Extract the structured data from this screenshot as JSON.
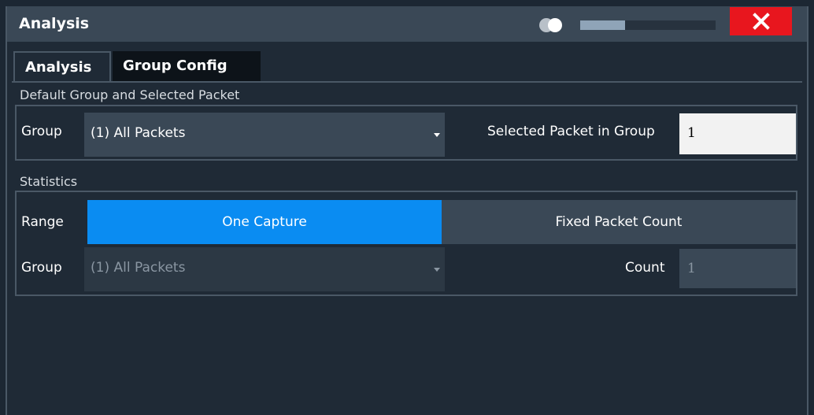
{
  "window": {
    "title": "Analysis",
    "progress": 0.33
  },
  "tabs": [
    {
      "label": "Analysis",
      "active": true
    },
    {
      "label": "Group Config",
      "active": false
    }
  ],
  "default_group": {
    "section_label": "Default Group and Selected Packet",
    "group_label": "Group",
    "group_value": "(1) All Packets",
    "selected_packet_label": "Selected Packet in Group",
    "selected_packet_value": "1"
  },
  "statistics": {
    "section_label": "Statistics",
    "range_label": "Range",
    "range_options": [
      "One Capture",
      "Fixed Packet Count"
    ],
    "range_selected": "One Capture",
    "group_label": "Group",
    "group_value": "(1) All Packets",
    "count_label": "Count",
    "count_value": "1"
  },
  "colors": {
    "accent": "#0a8cf2",
    "close": "#e8161e",
    "background": "#1f2a36",
    "control": "#3a4856"
  },
  "icons": {
    "toggle": "toggle-circles-icon",
    "close": "close-x-icon",
    "dropdown": "chevron-down-icon"
  }
}
